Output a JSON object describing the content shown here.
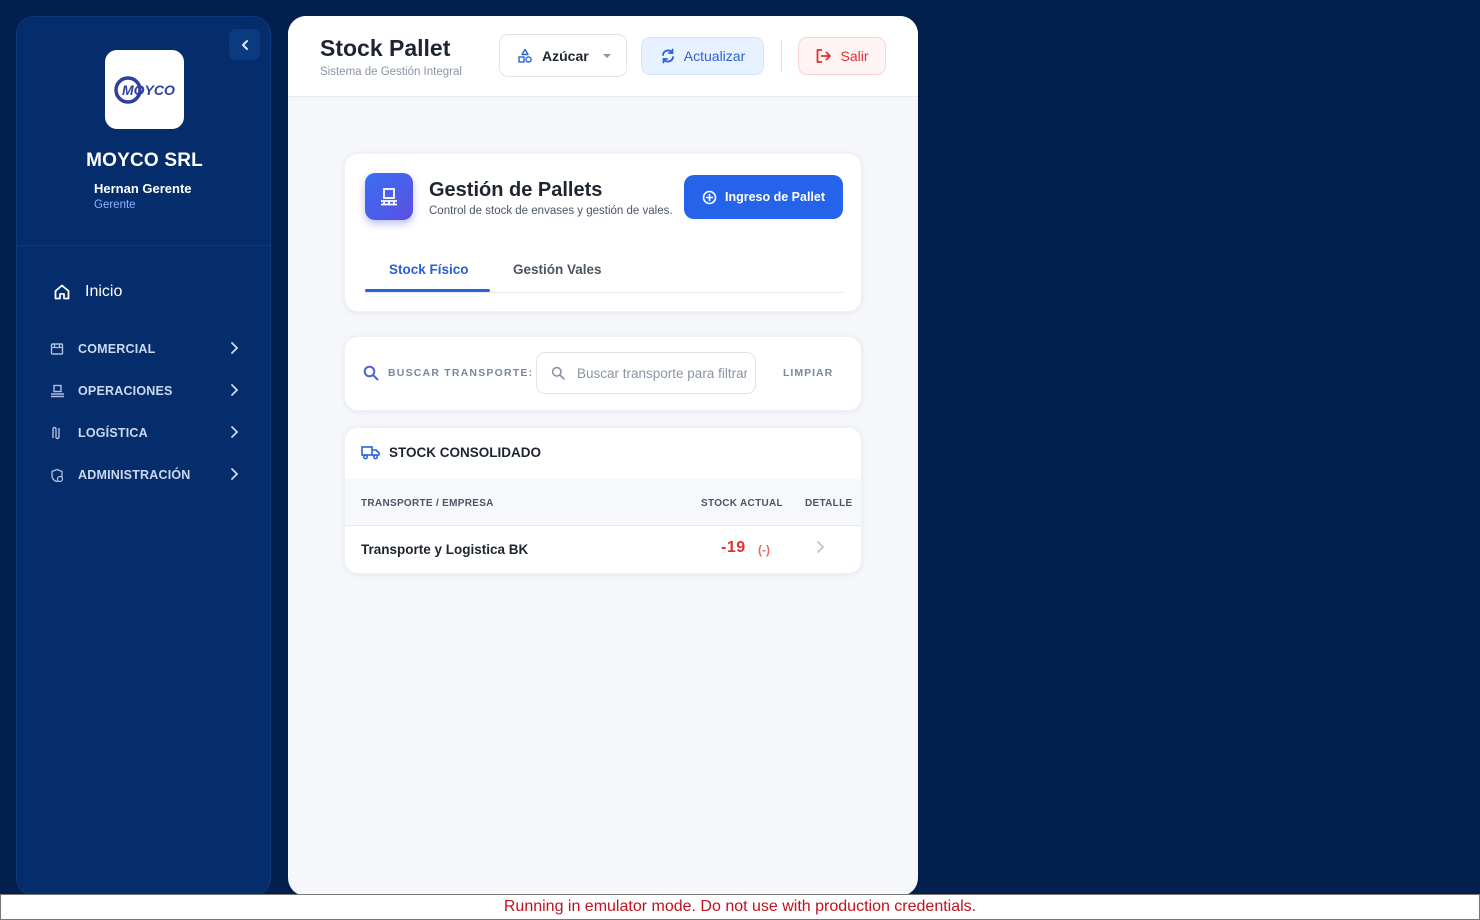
{
  "sidebar": {
    "company": "MOYCO SRL",
    "logo_text": "MOYCO",
    "user_name": "Hernan Gerente",
    "user_role": "Gerente",
    "home_label": "Inicio",
    "items": [
      {
        "label": "COMERCIAL",
        "icon": "store-icon"
      },
      {
        "label": "OPERACIONES",
        "icon": "forklift-icon"
      },
      {
        "label": "LOGÍSTICA",
        "icon": "route-icon"
      },
      {
        "label": "ADMINISTRACIÓN",
        "icon": "shield-clock-icon"
      }
    ]
  },
  "header": {
    "title": "Stock Pallet",
    "subtitle": "Sistema de Gestión Integral",
    "product_selected": "Azúcar",
    "refresh_label": "Actualizar",
    "exit_label": "Salir"
  },
  "management": {
    "title": "Gestión de Pallets",
    "subtitle": "Control de stock de envases y gestión de vales.",
    "add_button": "Ingreso de Pallet",
    "tabs": [
      {
        "label": "Stock Físico",
        "active": true
      },
      {
        "label": "Gestión Vales",
        "active": false
      }
    ]
  },
  "search": {
    "label": "BUSCAR TRANSPORTE:",
    "placeholder": "Buscar transporte para filtrar",
    "clear_label": "LIMPIAR"
  },
  "stock": {
    "title": "STOCK CONSOLIDADO",
    "columns": [
      "TRANSPORTE / EMPRESA",
      "STOCK ACTUAL",
      "DETALLE"
    ],
    "rows": [
      {
        "name": "Transporte y Logistica BK",
        "stock": "-19",
        "sign": "(-)"
      }
    ]
  },
  "banner": "Running in emulator mode. Do not use with production credentials.",
  "colors": {
    "background": "#021f4d",
    "sidebar": "#062d6b",
    "accent": "#2563eb",
    "danger": "#e03131"
  }
}
